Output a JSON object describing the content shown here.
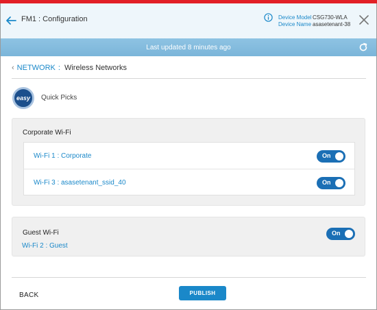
{
  "header": {
    "title": "FM1 : Configuration",
    "device_model_label": "Device Model",
    "device_model_value": "CSG730-WLA",
    "device_name_label": "Device Name",
    "device_name_value": "asasetenant-38",
    "icons": [
      "back-arrow-icon",
      "info-icon",
      "close-icon"
    ]
  },
  "status": {
    "text": "Last updated 8 minutes ago",
    "icon": "refresh-icon"
  },
  "breadcrumb": {
    "parent": "NETWORK",
    "separator": ":",
    "current": "Wireless Networks"
  },
  "quick_picks": {
    "badge": "easy",
    "label": "Quick Picks"
  },
  "corporate": {
    "title": "Corporate Wi-Fi",
    "networks": [
      {
        "label": "Wi-Fi 1 : Corporate",
        "state": "On"
      },
      {
        "label": "Wi-Fi 3 : asasetenant_ssid_40",
        "state": "On"
      }
    ]
  },
  "guest": {
    "title": "Guest Wi-Fi",
    "network": "Wi-Fi 2 : Guest",
    "state": "On"
  },
  "footer": {
    "back_label": "BACK",
    "publish_label": "PUBLISH"
  },
  "colors": {
    "accent": "#1a88c9",
    "toggle": "#1b6fb5",
    "brand_bar": "#e21f26",
    "status_bar": "#8ec3e3"
  }
}
